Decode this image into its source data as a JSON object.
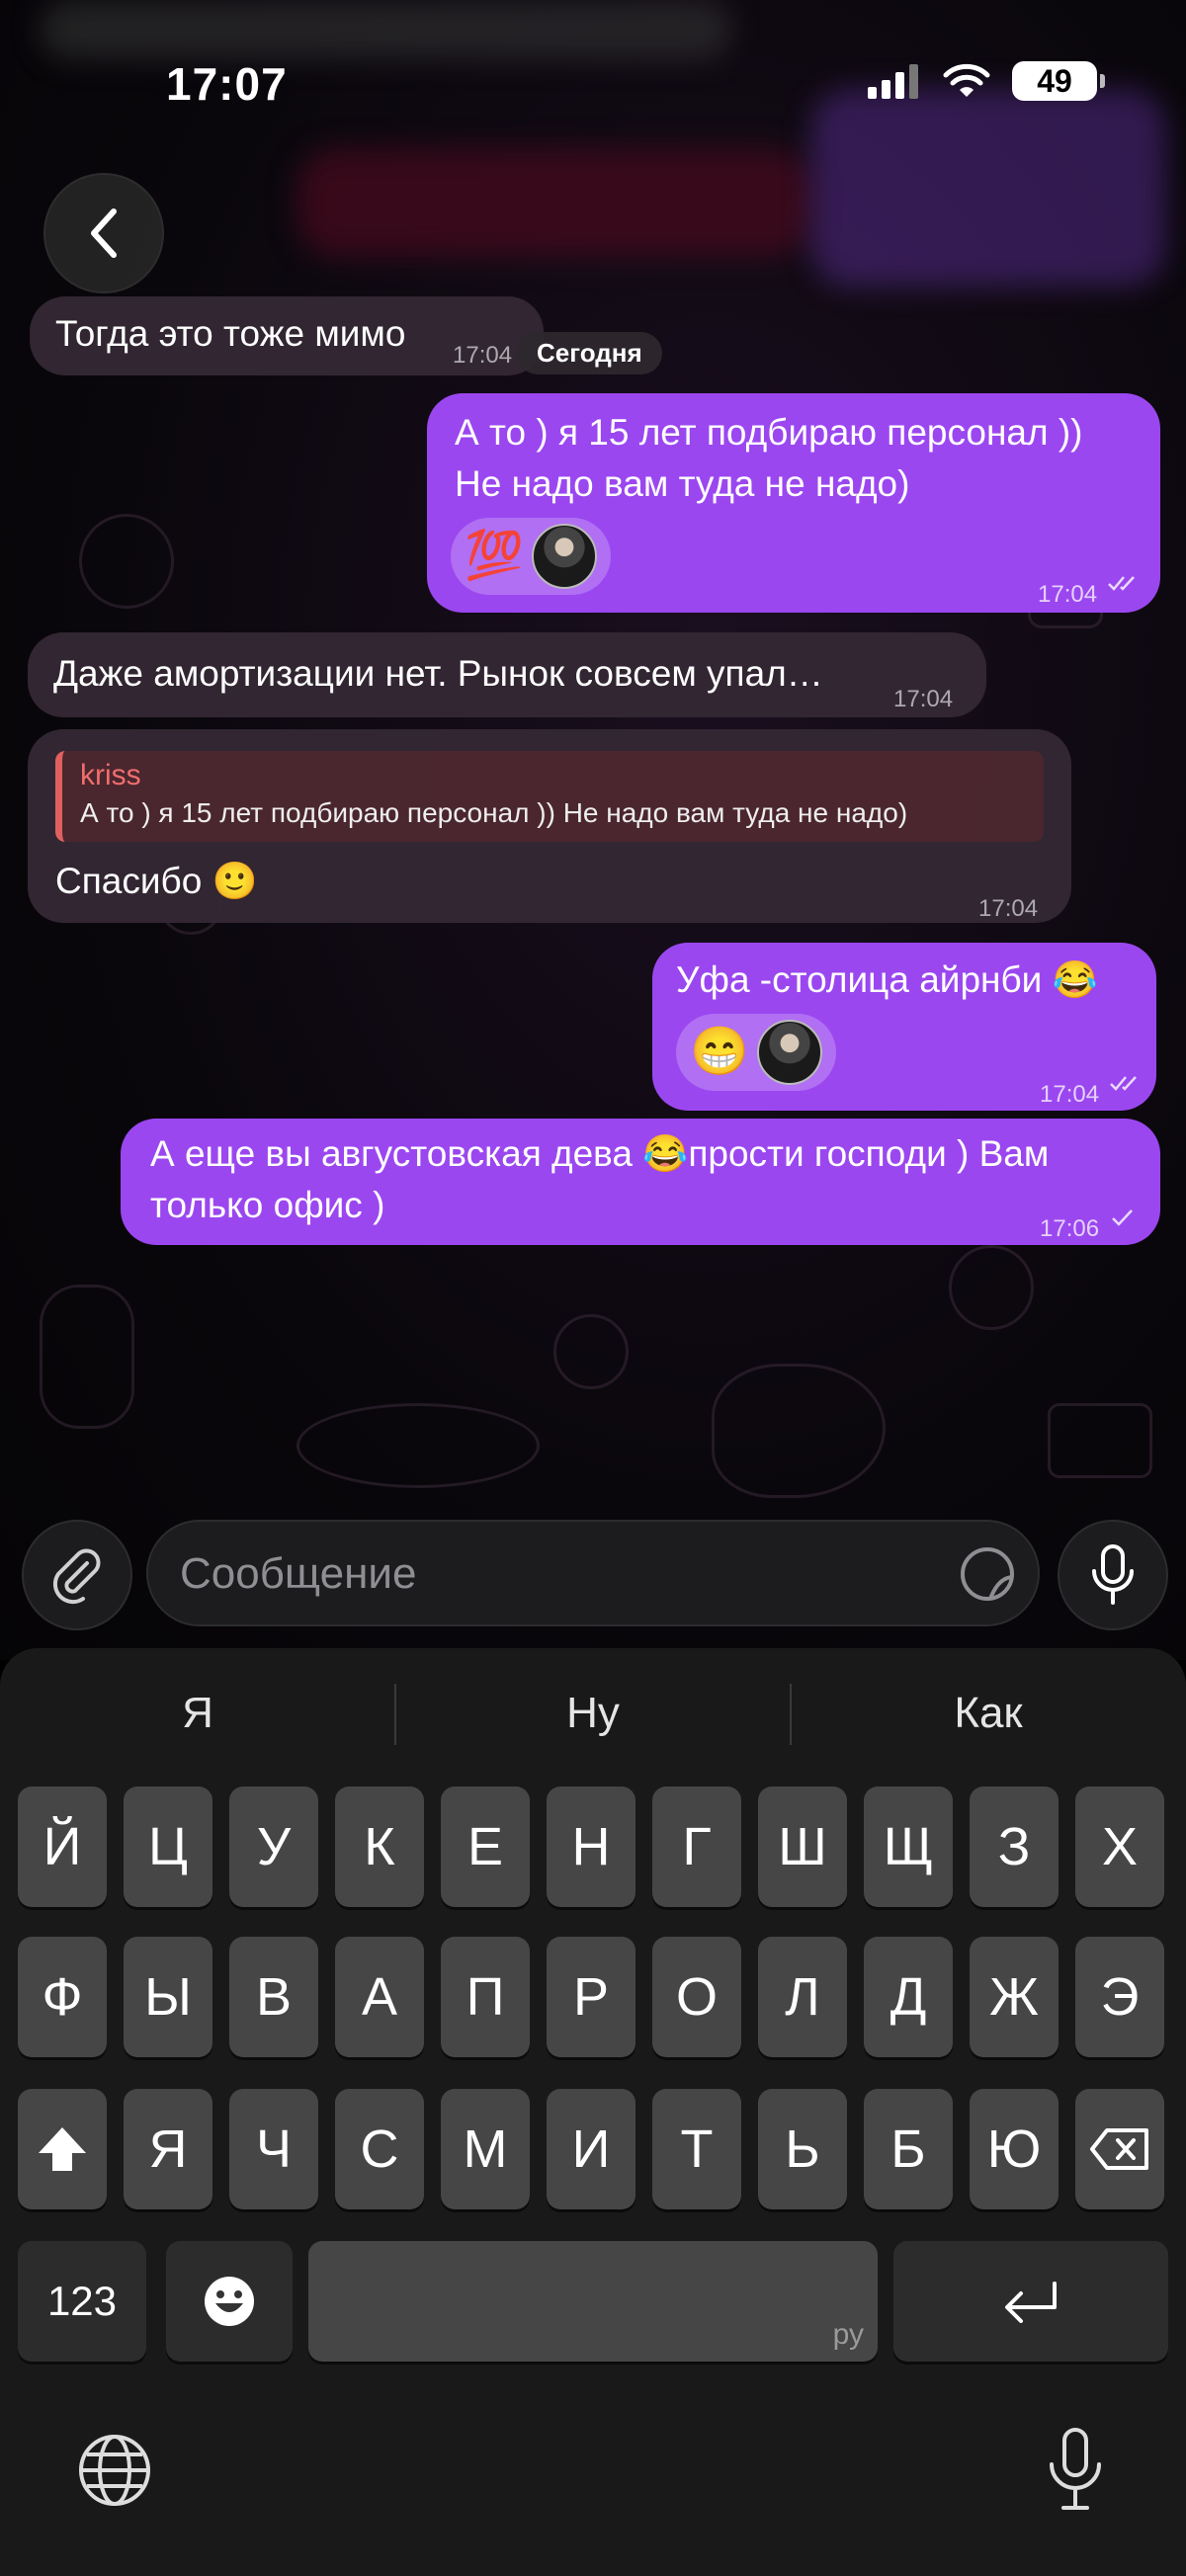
{
  "status_bar": {
    "time": "17:07",
    "battery": "49"
  },
  "chat": {
    "date_pill": "Сегодня",
    "messages": [
      {
        "type": "incoming",
        "text": "Тогда это тоже мимо",
        "time": "17:04"
      },
      {
        "type": "outgoing",
        "text_line1": "А то ) я 15 лет подбираю персонал ))",
        "text_line2": "Не надо вам туда не надо)",
        "reaction": "💯",
        "time": "17:04"
      },
      {
        "type": "incoming",
        "text": "Даже амортизации нет. Рынок совсем упал…",
        "time": "17:04"
      },
      {
        "type": "incoming",
        "reply_name": "kriss",
        "reply_text": "А то ) я 15 лет подбираю персонал )) Не надо вам туда не надо)",
        "text": "Спасибо 🙂",
        "time": "17:04"
      },
      {
        "type": "outgoing",
        "text": "Уфа -столица айрнби 😂",
        "reaction": "😁",
        "time": "17:04"
      },
      {
        "type": "outgoing",
        "text_line1": "А еще вы августовская дева 😂прости господи ) Вам",
        "text_line2": "только офис )",
        "time": "17:06"
      }
    ]
  },
  "input": {
    "placeholder": "Сообщение"
  },
  "keyboard": {
    "suggestions": [
      "Я",
      "Ну",
      "Как"
    ],
    "row1": [
      "Й",
      "Ц",
      "У",
      "К",
      "Е",
      "Н",
      "Г",
      "Ш",
      "Щ",
      "З",
      "Х"
    ],
    "row2": [
      "Ф",
      "Ы",
      "В",
      "А",
      "П",
      "Р",
      "О",
      "Л",
      "Д",
      "Ж",
      "Э"
    ],
    "row3": [
      "Я",
      "Ч",
      "С",
      "М",
      "И",
      "Т",
      "Ь",
      "Б",
      "Ю"
    ],
    "numbers_label": "123",
    "space_label": "ру"
  },
  "colors": {
    "outgoing_bubble": "#9b47f0",
    "incoming_bubble": "#342834",
    "reply_accent": "#e06060"
  }
}
